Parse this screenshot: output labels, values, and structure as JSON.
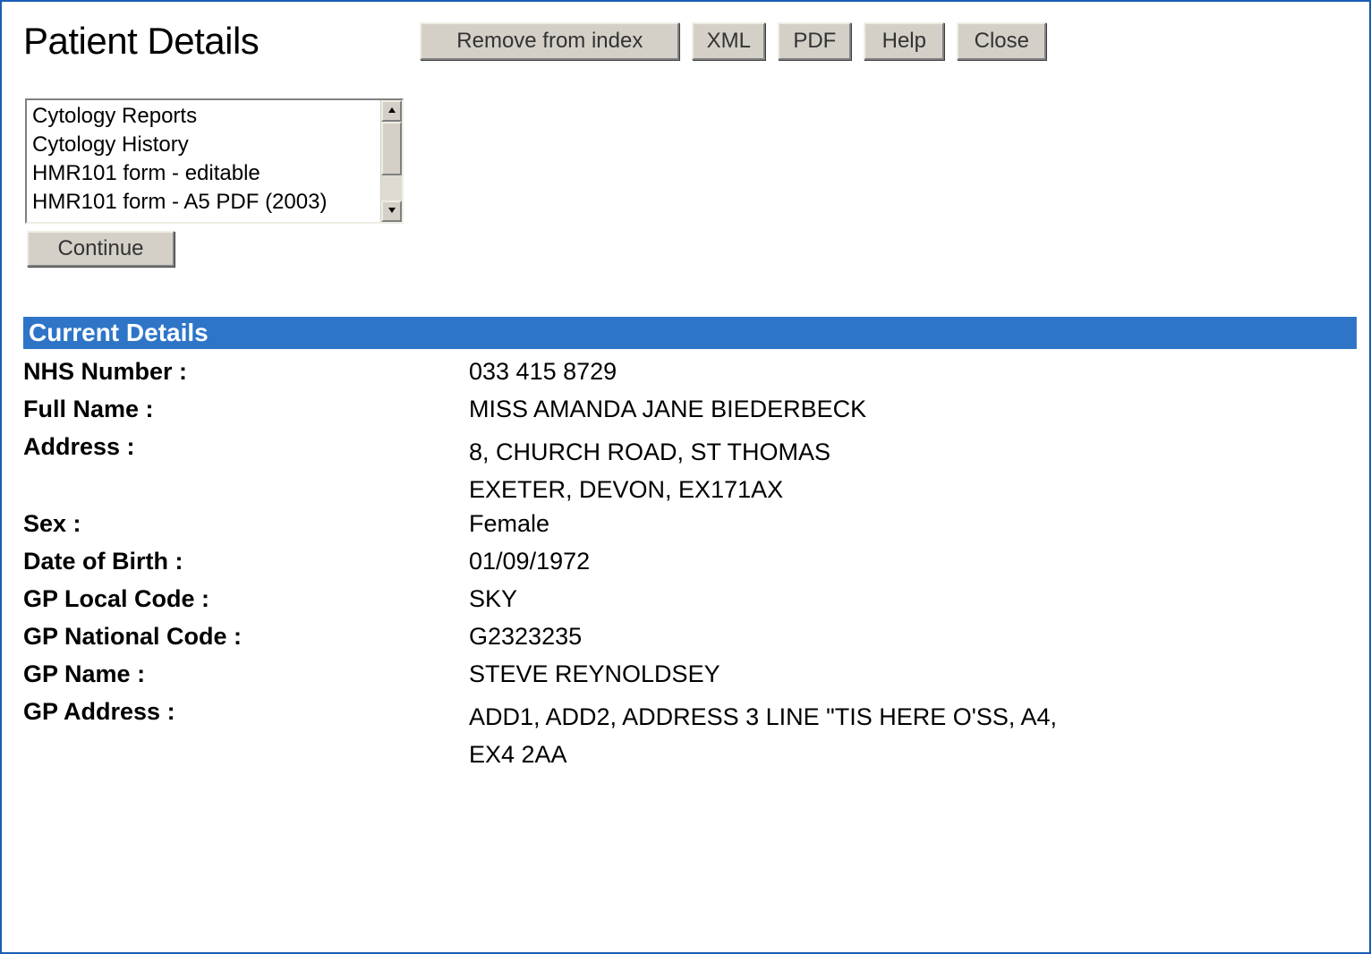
{
  "page_title": "Patient Details",
  "toolbar": {
    "remove_label": "Remove from index",
    "xml_label": "XML",
    "pdf_label": "PDF",
    "help_label": "Help",
    "close_label": "Close"
  },
  "listbox": {
    "items": [
      "Cytology Reports",
      "Cytology History",
      "HMR101 form - editable",
      "HMR101 form - A5 PDF (2003)"
    ],
    "continue_label": "Continue"
  },
  "section": {
    "header": "Current Details",
    "fields": {
      "nhs_number": {
        "label": "NHS Number :",
        "value": "033 415 8729"
      },
      "full_name": {
        "label": "Full Name :",
        "value": "MISS AMANDA JANE BIEDERBECK"
      },
      "address": {
        "label": "Address :",
        "value_line1": "8, CHURCH ROAD, ST THOMAS",
        "value_line2": "EXETER, DEVON, EX171AX"
      },
      "sex": {
        "label": "Sex :",
        "value": "Female"
      },
      "dob": {
        "label": "Date of Birth :",
        "value": "01/09/1972"
      },
      "gp_local": {
        "label": "GP Local Code :",
        "value": "SKY"
      },
      "gp_national": {
        "label": "GP National Code :",
        "value": "G2323235"
      },
      "gp_name": {
        "label": "GP Name :",
        "value": "STEVE REYNOLDSEY"
      },
      "gp_address": {
        "label": "GP Address :",
        "value_line1": "ADD1, ADD2, ADDRESS 3 LINE \"TIS HERE O'SS, A4,",
        "value_line2": "EX4 2AA"
      }
    }
  }
}
